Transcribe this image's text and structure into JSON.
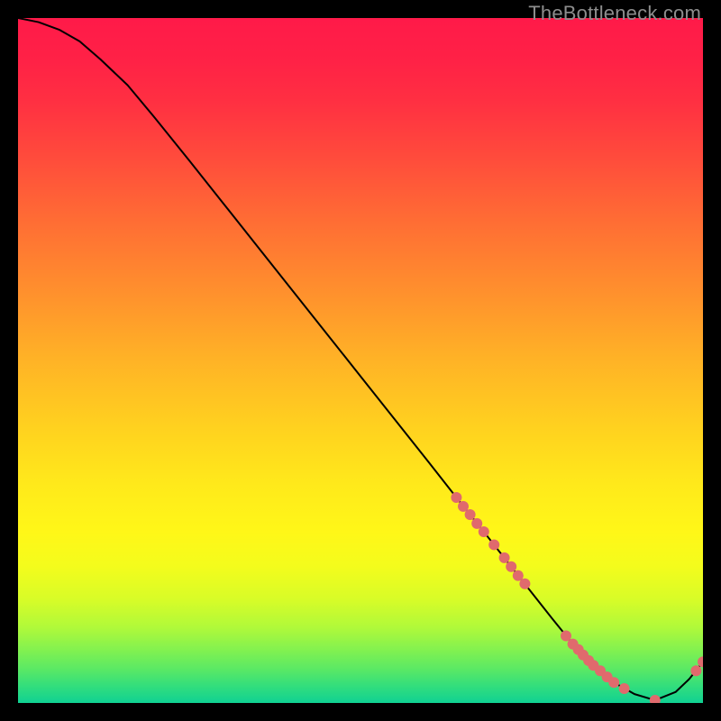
{
  "watermark": "TheBottleneck.com",
  "chart_data": {
    "type": "line",
    "title": "",
    "xlabel": "",
    "ylabel": "",
    "xlim": [
      0,
      100
    ],
    "ylim": [
      0,
      100
    ],
    "grid": false,
    "legend": false,
    "background_gradient_stops": [
      {
        "offset": 0.0,
        "color": "#ff1a49"
      },
      {
        "offset": 0.06,
        "color": "#ff2146"
      },
      {
        "offset": 0.12,
        "color": "#ff2f42"
      },
      {
        "offset": 0.2,
        "color": "#ff4a3c"
      },
      {
        "offset": 0.3,
        "color": "#ff6e34"
      },
      {
        "offset": 0.4,
        "color": "#ff902d"
      },
      {
        "offset": 0.5,
        "color": "#ffb326"
      },
      {
        "offset": 0.6,
        "color": "#ffd21f"
      },
      {
        "offset": 0.68,
        "color": "#ffe91b"
      },
      {
        "offset": 0.75,
        "color": "#fff718"
      },
      {
        "offset": 0.8,
        "color": "#f4fc1c"
      },
      {
        "offset": 0.85,
        "color": "#d7fc28"
      },
      {
        "offset": 0.89,
        "color": "#b0f93a"
      },
      {
        "offset": 0.92,
        "color": "#86f24e"
      },
      {
        "offset": 0.95,
        "color": "#5be964"
      },
      {
        "offset": 0.975,
        "color": "#33de7c"
      },
      {
        "offset": 1.0,
        "color": "#10d193"
      }
    ],
    "series": [
      {
        "name": "bottleneck-curve",
        "color": "#000000",
        "x": [
          0,
          3,
          6,
          9,
          12,
          16,
          20,
          25,
          30,
          35,
          40,
          45,
          50,
          55,
          60,
          64,
          68,
          72,
          75,
          78,
          81,
          84,
          87,
          90,
          93,
          96,
          98,
          100
        ],
        "y": [
          100,
          99.4,
          98.3,
          96.6,
          94.0,
          90.2,
          85.4,
          79.2,
          72.9,
          66.6,
          60.3,
          54.0,
          47.7,
          41.4,
          35.1,
          30.0,
          25.0,
          19.9,
          16.1,
          12.3,
          8.6,
          5.5,
          3.0,
          1.3,
          0.4,
          1.6,
          3.5,
          6.0
        ]
      }
    ],
    "markers": {
      "name": "highlight-points",
      "color": "#e06a6d",
      "radius_px": 6,
      "points": [
        {
          "x": 64.0,
          "y": 30.0
        },
        {
          "x": 65.0,
          "y": 28.7
        },
        {
          "x": 66.0,
          "y": 27.5
        },
        {
          "x": 67.0,
          "y": 26.2
        },
        {
          "x": 68.0,
          "y": 25.0
        },
        {
          "x": 69.5,
          "y": 23.1
        },
        {
          "x": 71.0,
          "y": 21.2
        },
        {
          "x": 72.0,
          "y": 19.9
        },
        {
          "x": 73.0,
          "y": 18.6
        },
        {
          "x": 74.0,
          "y": 17.4
        },
        {
          "x": 80.0,
          "y": 9.8
        },
        {
          "x": 81.0,
          "y": 8.6
        },
        {
          "x": 81.8,
          "y": 7.8
        },
        {
          "x": 82.5,
          "y": 7.0
        },
        {
          "x": 83.3,
          "y": 6.2
        },
        {
          "x": 84.0,
          "y": 5.5
        },
        {
          "x": 85.0,
          "y": 4.7
        },
        {
          "x": 86.0,
          "y": 3.8
        },
        {
          "x": 87.0,
          "y": 3.0
        },
        {
          "x": 88.5,
          "y": 2.1
        },
        {
          "x": 93.0,
          "y": 0.4
        },
        {
          "x": 99.0,
          "y": 4.7
        },
        {
          "x": 100.0,
          "y": 6.0
        }
      ]
    }
  }
}
